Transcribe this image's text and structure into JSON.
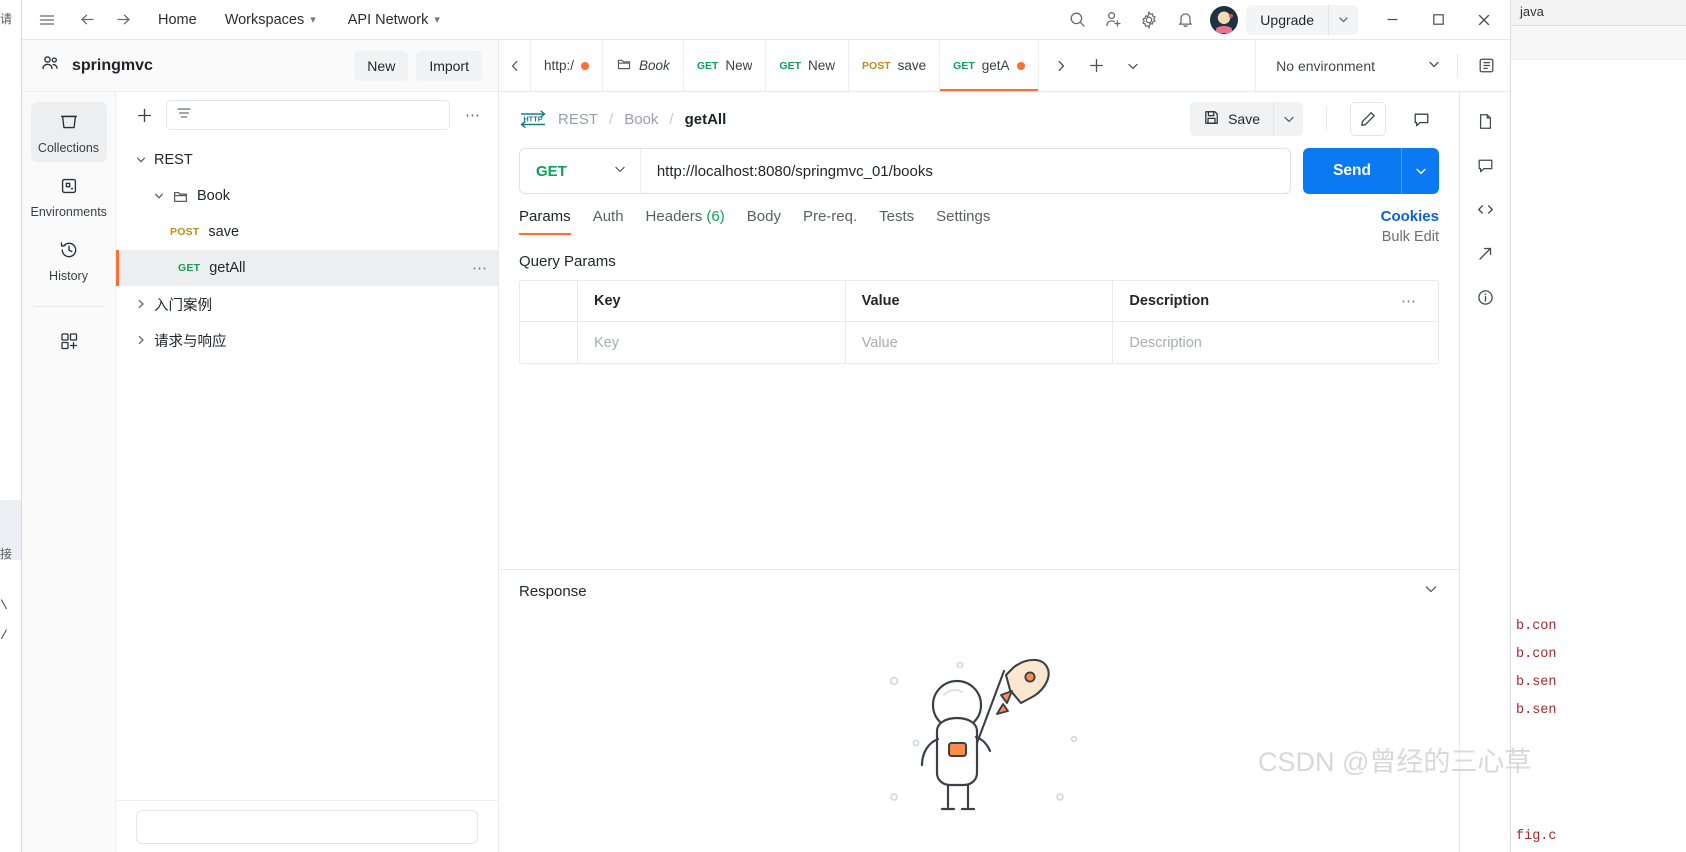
{
  "titlebar": {
    "hamburger_icon": "hamburger-icon",
    "back_icon": "arrow-left-icon",
    "forward_icon": "arrow-right-icon",
    "home_label": "Home",
    "workspaces_label": "Workspaces",
    "api_network_label": "API Network",
    "search_icon": "search-icon",
    "invite_icon": "user-plus-icon",
    "settings_icon": "gear-icon",
    "notifications_icon": "bell-icon",
    "avatar_label": "avatar",
    "upgrade_label": "Upgrade",
    "minimize_label": "–",
    "maximize_label": "□",
    "close_label": "✕"
  },
  "sidebar": {
    "workspace_name": "springmvc",
    "new_label": "New",
    "import_label": "Import",
    "rail_items": [
      {
        "label": "Collections",
        "icon": "collections-icon",
        "active": true
      },
      {
        "label": "Environments",
        "icon": "environments-icon",
        "active": false
      },
      {
        "label": "History",
        "icon": "history-icon",
        "active": false
      }
    ],
    "rail_extra_icon": "add-apps-icon",
    "toolbar": {
      "add_icon": "plus-icon",
      "filter_icon": "filter-icon",
      "more_icon": "more-horizontal-icon",
      "search_placeholder": ""
    },
    "tree": [
      {
        "type": "collection",
        "label": "REST",
        "expanded": true,
        "depth": 0
      },
      {
        "type": "folder",
        "label": "Book",
        "expanded": true,
        "depth": 1
      },
      {
        "type": "request",
        "method": "POST",
        "label": "save",
        "depth": 2,
        "selected": false
      },
      {
        "type": "request",
        "method": "GET",
        "label": "getAll",
        "depth": 2,
        "selected": true
      },
      {
        "type": "collection",
        "label": "入门案例",
        "expanded": false,
        "depth": 0
      },
      {
        "type": "collection",
        "label": "请求与响应",
        "expanded": false,
        "depth": 0
      }
    ]
  },
  "tabbar": {
    "scroll_left_icon": "chevron-left-icon",
    "scroll_right_icon": "chevron-right-icon",
    "new_tab_icon": "plus-icon",
    "tab_list_icon": "chevron-down-icon",
    "tabs": [
      {
        "name": "http:/",
        "method": "",
        "kind": "url",
        "dirty": true,
        "active": false
      },
      {
        "name": "Book",
        "method": "",
        "kind": "folder",
        "dirty": false,
        "active": false,
        "italic": true
      },
      {
        "name": "New ",
        "method": "GET",
        "kind": "request",
        "dirty": false,
        "active": false
      },
      {
        "name": "New ",
        "method": "GET",
        "kind": "request",
        "dirty": false,
        "active": false
      },
      {
        "name": "save",
        "method": "POST",
        "kind": "request",
        "dirty": false,
        "active": false
      },
      {
        "name": "getA",
        "method": "GET",
        "kind": "request",
        "dirty": true,
        "active": true
      }
    ],
    "environment_label": "No environment",
    "environment_caret_icon": "chevron-down-icon",
    "env_quicklook_icon": "eye-icon"
  },
  "request": {
    "breadcrumb": {
      "protocol_badge": "HTTP",
      "items": [
        "REST",
        "Book",
        "getAll"
      ],
      "separator": "/"
    },
    "save_label": "Save",
    "save_icon": "floppy-disk-icon",
    "save_caret_icon": "chevron-down-icon",
    "edit_icon": "pencil-icon",
    "comment_icon": "comment-icon",
    "method": "GET",
    "method_caret_icon": "chevron-down-icon",
    "url": "http://localhost:8080/springmvc_01/books",
    "send_label": "Send",
    "send_caret_icon": "chevron-down-icon",
    "tabs": [
      {
        "label": "Params",
        "count": "",
        "active": true
      },
      {
        "label": "Auth",
        "count": "",
        "active": false
      },
      {
        "label": "Headers",
        "count": "(6)",
        "active": false
      },
      {
        "label": "Body",
        "count": "",
        "active": false
      },
      {
        "label": "Pre-req.",
        "count": "",
        "active": false
      },
      {
        "label": "Tests",
        "count": "",
        "active": false
      },
      {
        "label": "Settings",
        "count": "",
        "active": false
      }
    ],
    "cookies_label": "Cookies",
    "query_params": {
      "title": "Query Params",
      "columns": [
        "Key",
        "Value",
        "Description"
      ],
      "more_icon": "more-horizontal-icon",
      "bulk_edit_label": "Bulk Edit",
      "rows": [
        {
          "key": "Key",
          "value": "Value",
          "description": "Description",
          "placeholder": true
        }
      ]
    }
  },
  "response": {
    "title": "Response",
    "collapse_icon": "chevron-down-icon",
    "illustration": "astronaut-rocket-illustration"
  },
  "right_rail": {
    "icons": [
      "document-icon",
      "comment-icon",
      "code-icon",
      "share-icon",
      "info-icon"
    ]
  },
  "watermark": {
    "text": "CSDN @曾经的三心草"
  },
  "background_editor": {
    "left_fragments": [
      "请",
      "接"
    ],
    "right_tab_label": "java",
    "right_fragments": [
      "b.con",
      "b.con",
      "b.sen",
      "b.sen",
      "fig.c"
    ]
  },
  "colors": {
    "accent_orange": "#ff6c37",
    "send_blue": "#0b79f2",
    "get_green": "#10a05a",
    "post_yellow": "#c08a1e",
    "link_blue": "#0b63ce"
  }
}
